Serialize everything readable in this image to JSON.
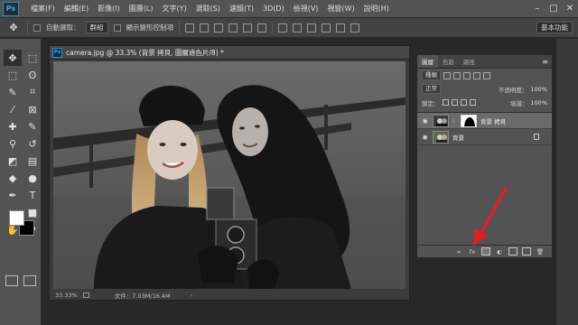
{
  "app": {
    "logo": "Ps"
  },
  "menu": {
    "items": [
      "檔案(F)",
      "編輯(E)",
      "影像(I)",
      "圖層(L)",
      "文字(Y)",
      "選取(S)",
      "濾鏡(T)",
      "3D(D)",
      "檢視(V)",
      "視窗(W)",
      "說明(H)"
    ]
  },
  "window_controls": {
    "minimize": "–",
    "maximize": "□",
    "close": "✕"
  },
  "options": {
    "auto_select_label": "自動選取：",
    "auto_select_value": "群組",
    "transform_label": "顯示變形控制項",
    "workspace": "基本功能"
  },
  "colors": {
    "foreground": "#ffffff",
    "background": "#000000",
    "accent": "#31a8ff",
    "arrow": "#e02020"
  },
  "document": {
    "icon": "Ps",
    "title": "camera.jpg @ 33.3% (背景 拷貝, 圖層遮色片/8) *",
    "status_zoom": "33.33%",
    "status_doc": "文件：7.03M/16.4M",
    "status_arrow": "›"
  },
  "layers_panel": {
    "tabs": [
      "圖層",
      "色版",
      "路徑"
    ],
    "menu_icon": "≡",
    "filter_type": "種類",
    "blend_mode": "正常",
    "opacity_label": "不透明度：",
    "opacity_value": "100%",
    "lock_label": "鎖定：",
    "fill_label": "填滿：",
    "fill_value": "100%",
    "layers": [
      {
        "name": "背景 拷貝",
        "visible": true,
        "selected": true,
        "has_mask": true
      },
      {
        "name": "背景",
        "visible": true,
        "selected": false,
        "locked": true
      }
    ],
    "footer_icons": [
      "link-layers-icon",
      "fx-icon",
      "add-mask-icon",
      "adjustment-icon",
      "group-icon",
      "new-layer-icon",
      "trash-icon"
    ],
    "footer_labels": {
      "link": "∞",
      "fx": "fx"
    }
  },
  "tools": [
    "move-tool-icon",
    "artboard-tool-icon",
    "marquee-tool-icon",
    "lasso-tool-icon",
    "quick-select-tool-icon",
    "crop-tool-icon",
    "eyedropper-tool-icon",
    "frame-tool-icon",
    "healing-brush-icon",
    "brush-tool-icon",
    "clone-stamp-icon",
    "history-brush-icon",
    "eraser-tool-icon",
    "gradient-tool-icon",
    "blur-tool-icon",
    "dodge-tool-icon",
    "pen-tool-icon",
    "type-tool-icon",
    "path-select-icon",
    "shape-tool-icon",
    "hand-tool-icon",
    "zoom-tool-icon"
  ]
}
